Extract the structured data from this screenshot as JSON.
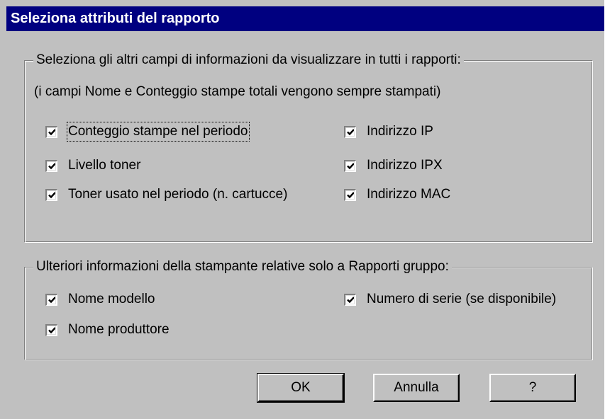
{
  "window": {
    "title": "Seleziona attributi del rapporto"
  },
  "group1": {
    "legend": "Seleziona gli altri campi di informazioni da visualizzare in tutti i rapporti:",
    "note": "(i campi Nome e Conteggio stampe totali vengono sempre stampati)",
    "checkboxes": [
      {
        "label": "Conteggio stampe nel periodo",
        "checked": true
      },
      {
        "label": "Livello toner",
        "checked": true
      },
      {
        "label": "Toner usato nel periodo (n. cartucce)",
        "checked": true
      },
      {
        "label": "Indirizzo IP",
        "checked": true
      },
      {
        "label": "Indirizzo IPX",
        "checked": true
      },
      {
        "label": "Indirizzo MAC",
        "checked": true
      }
    ]
  },
  "group2": {
    "legend": "Ulteriori informazioni della stampante relative solo a Rapporti gruppo:",
    "checkboxes": [
      {
        "label": "Nome modello",
        "checked": true
      },
      {
        "label": "Nome produttore",
        "checked": true
      },
      {
        "label": "Numero di serie (se disponibile)",
        "checked": true
      }
    ]
  },
  "buttons": {
    "ok": "OK",
    "cancel": "Annulla",
    "help": "?"
  }
}
